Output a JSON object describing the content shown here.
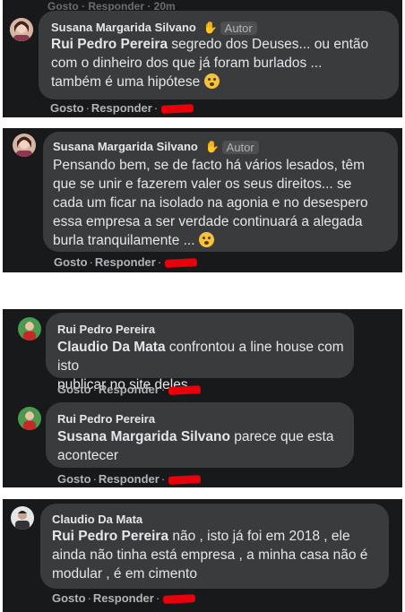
{
  "top_cut": {
    "text": "Gosto · Responder · 20m"
  },
  "comments": [
    {
      "author": "Susana Margarida Silvano",
      "badge": "Autor",
      "mention": "Rui Pedro Pereira",
      "lines": [
        " segredo dos Deuses... ou então",
        "com o dinheiro dos que já foram burlados ...",
        "também é uma hipótese "
      ],
      "like": "Gosto",
      "reply": "Responder",
      "avatar_color": "#c9a090"
    },
    {
      "author": "Susana Margarida Silvano",
      "badge": "Autor",
      "lines": [
        "Pensando bem, se de facto há vários lesados, têm",
        "que se unir e fazerem valer os seus direitos... se",
        "cada um ficar na isolado na agonia e no desespero",
        "essa empresa a ser verdade continuará a alegada",
        "burla tranquilamente ... "
      ],
      "like": "Gosto",
      "reply": "Responder",
      "avatar_color": "#c9a090"
    },
    {
      "author": "Rui Pedro Pereira",
      "mention": "Claudio Da Mata",
      "lines": [
        " confrontou a line house com isto",
        "publicar no site deles"
      ],
      "like": "Gosto",
      "reply": "Responder",
      "avatar_color": "#3b8a3e"
    },
    {
      "author": "Rui Pedro Pereira",
      "mention": "Susana Margarida Silvano",
      "lines": [
        " parece que esta",
        "acontecer"
      ],
      "like": "Gosto",
      "reply": "Responder",
      "avatar_color": "#3b8a3e"
    },
    {
      "author": "Claudio Da Mata",
      "mention": "Rui Pedro Pereira",
      "lines": [
        " não , isto já foi em 2018 , ele",
        "ainda não tinha está empresa , a minha casa não é",
        "modular , é em cimento"
      ],
      "like": "Gosto",
      "reply": "Responder",
      "avatar_color": "#d8d8d8"
    }
  ]
}
